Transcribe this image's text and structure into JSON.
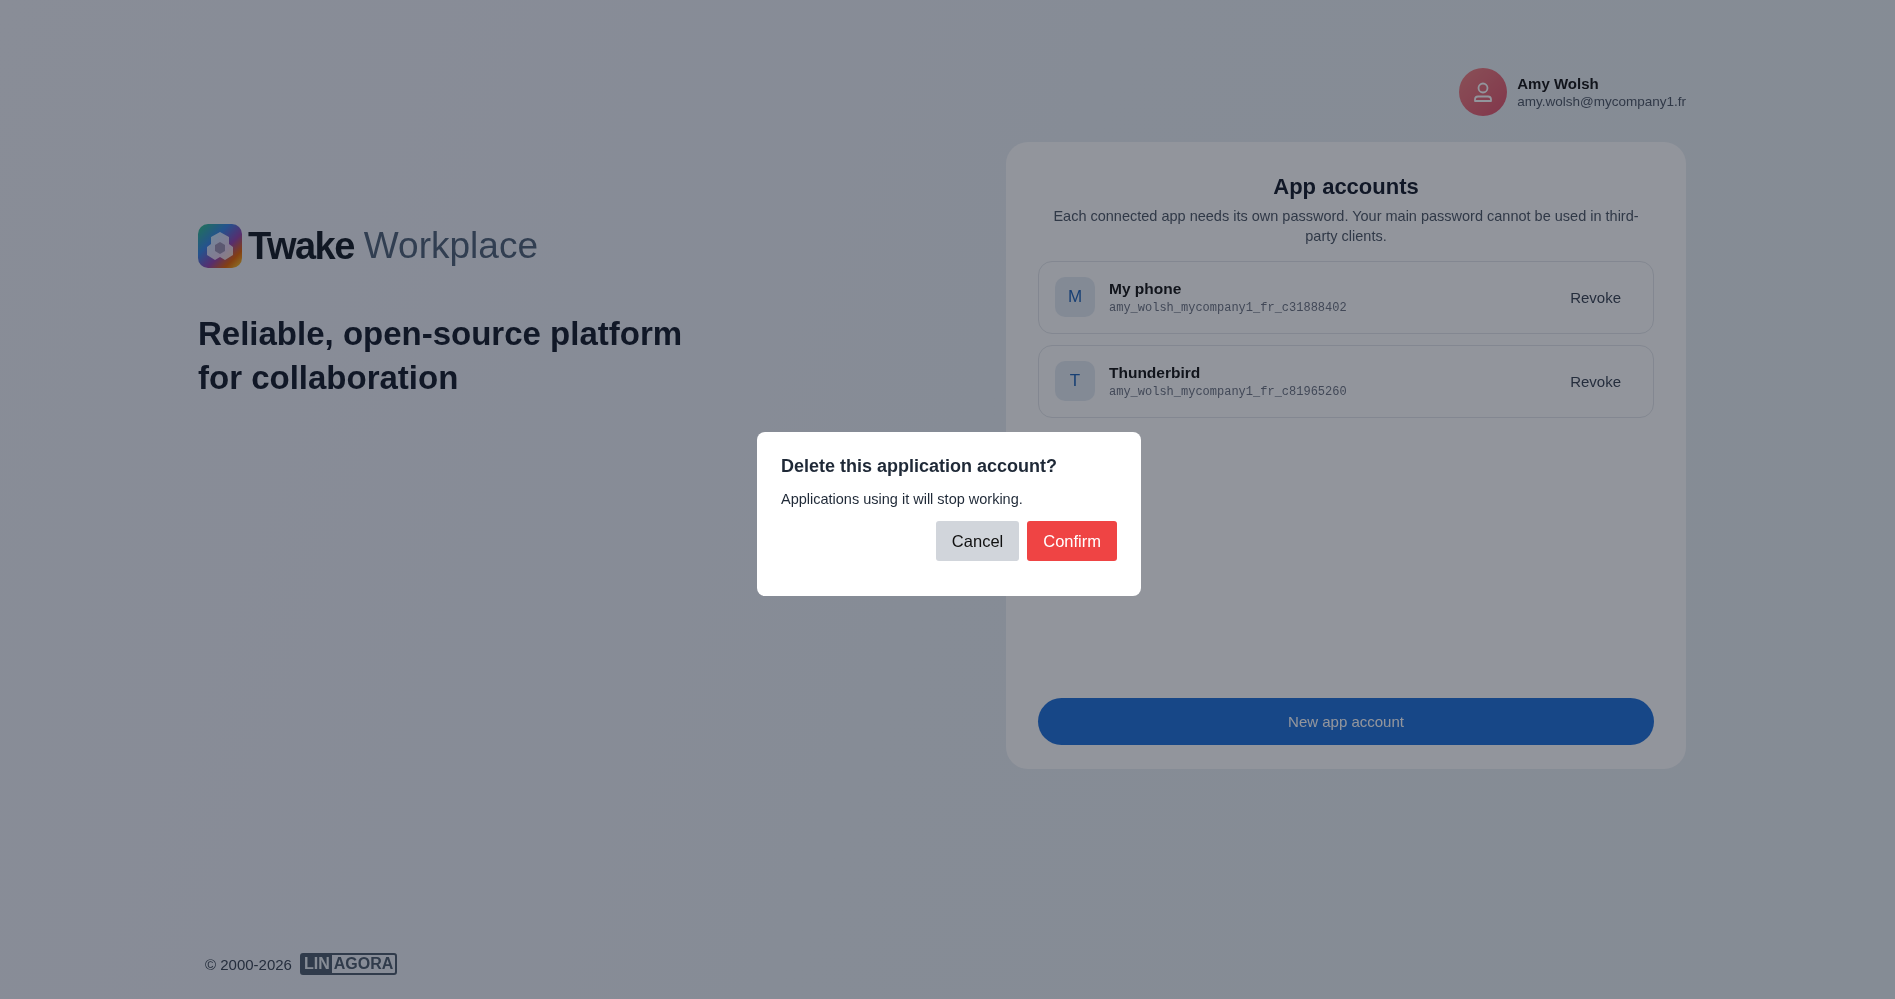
{
  "brand": {
    "name": "Twake",
    "product": "Workplace"
  },
  "tagline": "Reliable, open-source platform for collaboration",
  "user": {
    "name": "Amy Wolsh",
    "email": "amy.wolsh@mycompany1.fr"
  },
  "panel": {
    "title": "App accounts",
    "description": "Each connected app needs its own password. Your main password cannot be used in third-party clients.",
    "accounts": [
      {
        "initial": "M",
        "name": "My phone",
        "username": "amy_wolsh_mycompany1_fr_c31888402",
        "action": "Revoke"
      },
      {
        "initial": "T",
        "name": "Thunderbird",
        "username": "amy_wolsh_mycompany1_fr_c81965260",
        "action": "Revoke"
      }
    ],
    "new_button": "New app account"
  },
  "footer": {
    "copyright": "© 2000-2026",
    "logo": [
      "LIN",
      "AGORA"
    ]
  },
  "dialog": {
    "title": "Delete this application account?",
    "message": "Applications using it will stop working.",
    "buttons": [
      {
        "label": "Cancel",
        "kind": "secondary"
      },
      {
        "label": "Confirm",
        "kind": "danger"
      }
    ]
  }
}
